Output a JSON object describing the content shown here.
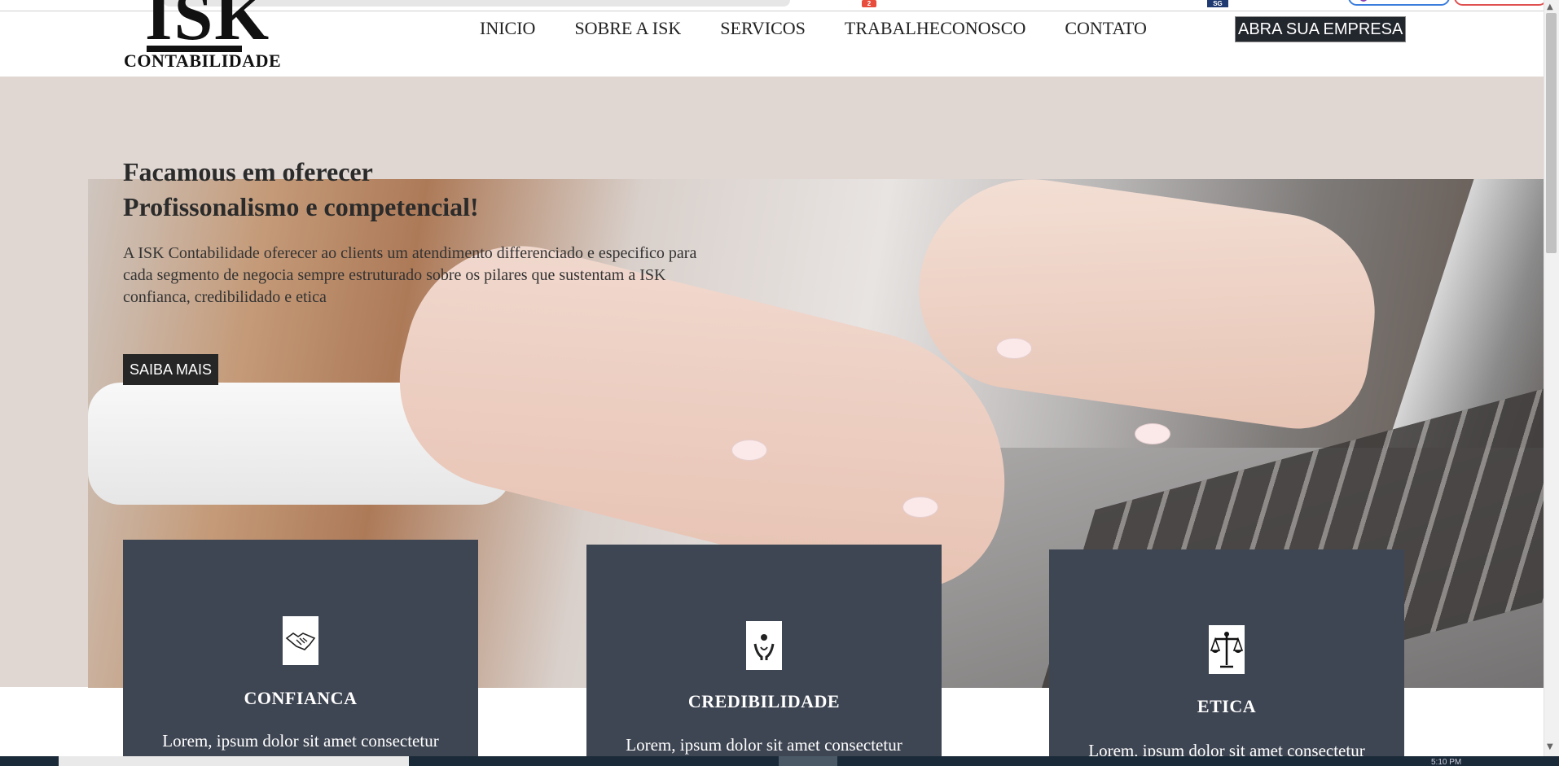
{
  "browser": {
    "notification_badge": "2",
    "extension_badge": "SG"
  },
  "header": {
    "logo_mark": "ISK",
    "logo_text": "CONTABILIDADE",
    "nav": [
      {
        "label": "INICIO"
      },
      {
        "label": "SOBRE A ISK"
      },
      {
        "label": "SERVICOS"
      },
      {
        "label": "TRABALHECONOSCO"
      },
      {
        "label": "CONTATO"
      }
    ],
    "cta_label": "ABRA SUA EMPRESA"
  },
  "hero": {
    "title_line1": "Facamous em oferecer",
    "title_line2": "Profissonalismo e competencial!",
    "description": "A ISK Contabilidade oferecer ao clients um atendimento differenciado e especifico para cada segmento de negocia sempre estruturado sobre os pilares que sustentam a ISK confianca, credibilidado e etica",
    "button_label": "SAIBA MAIS"
  },
  "cards": [
    {
      "title": "CONFIANCA",
      "text": "Lorem, ipsum dolor sit amet consectetur",
      "icon": "handshake-icon"
    },
    {
      "title": "CREDIBILIDADE",
      "text": "Lorem, ipsum dolor sit amet consectetur",
      "icon": "hands-care-icon"
    },
    {
      "title": "ETICA",
      "text": "Lorem, ipsum dolor sit amet consectetur",
      "icon": "scales-icon"
    }
  ],
  "taskbar": {
    "clock": "5:10 PM"
  }
}
